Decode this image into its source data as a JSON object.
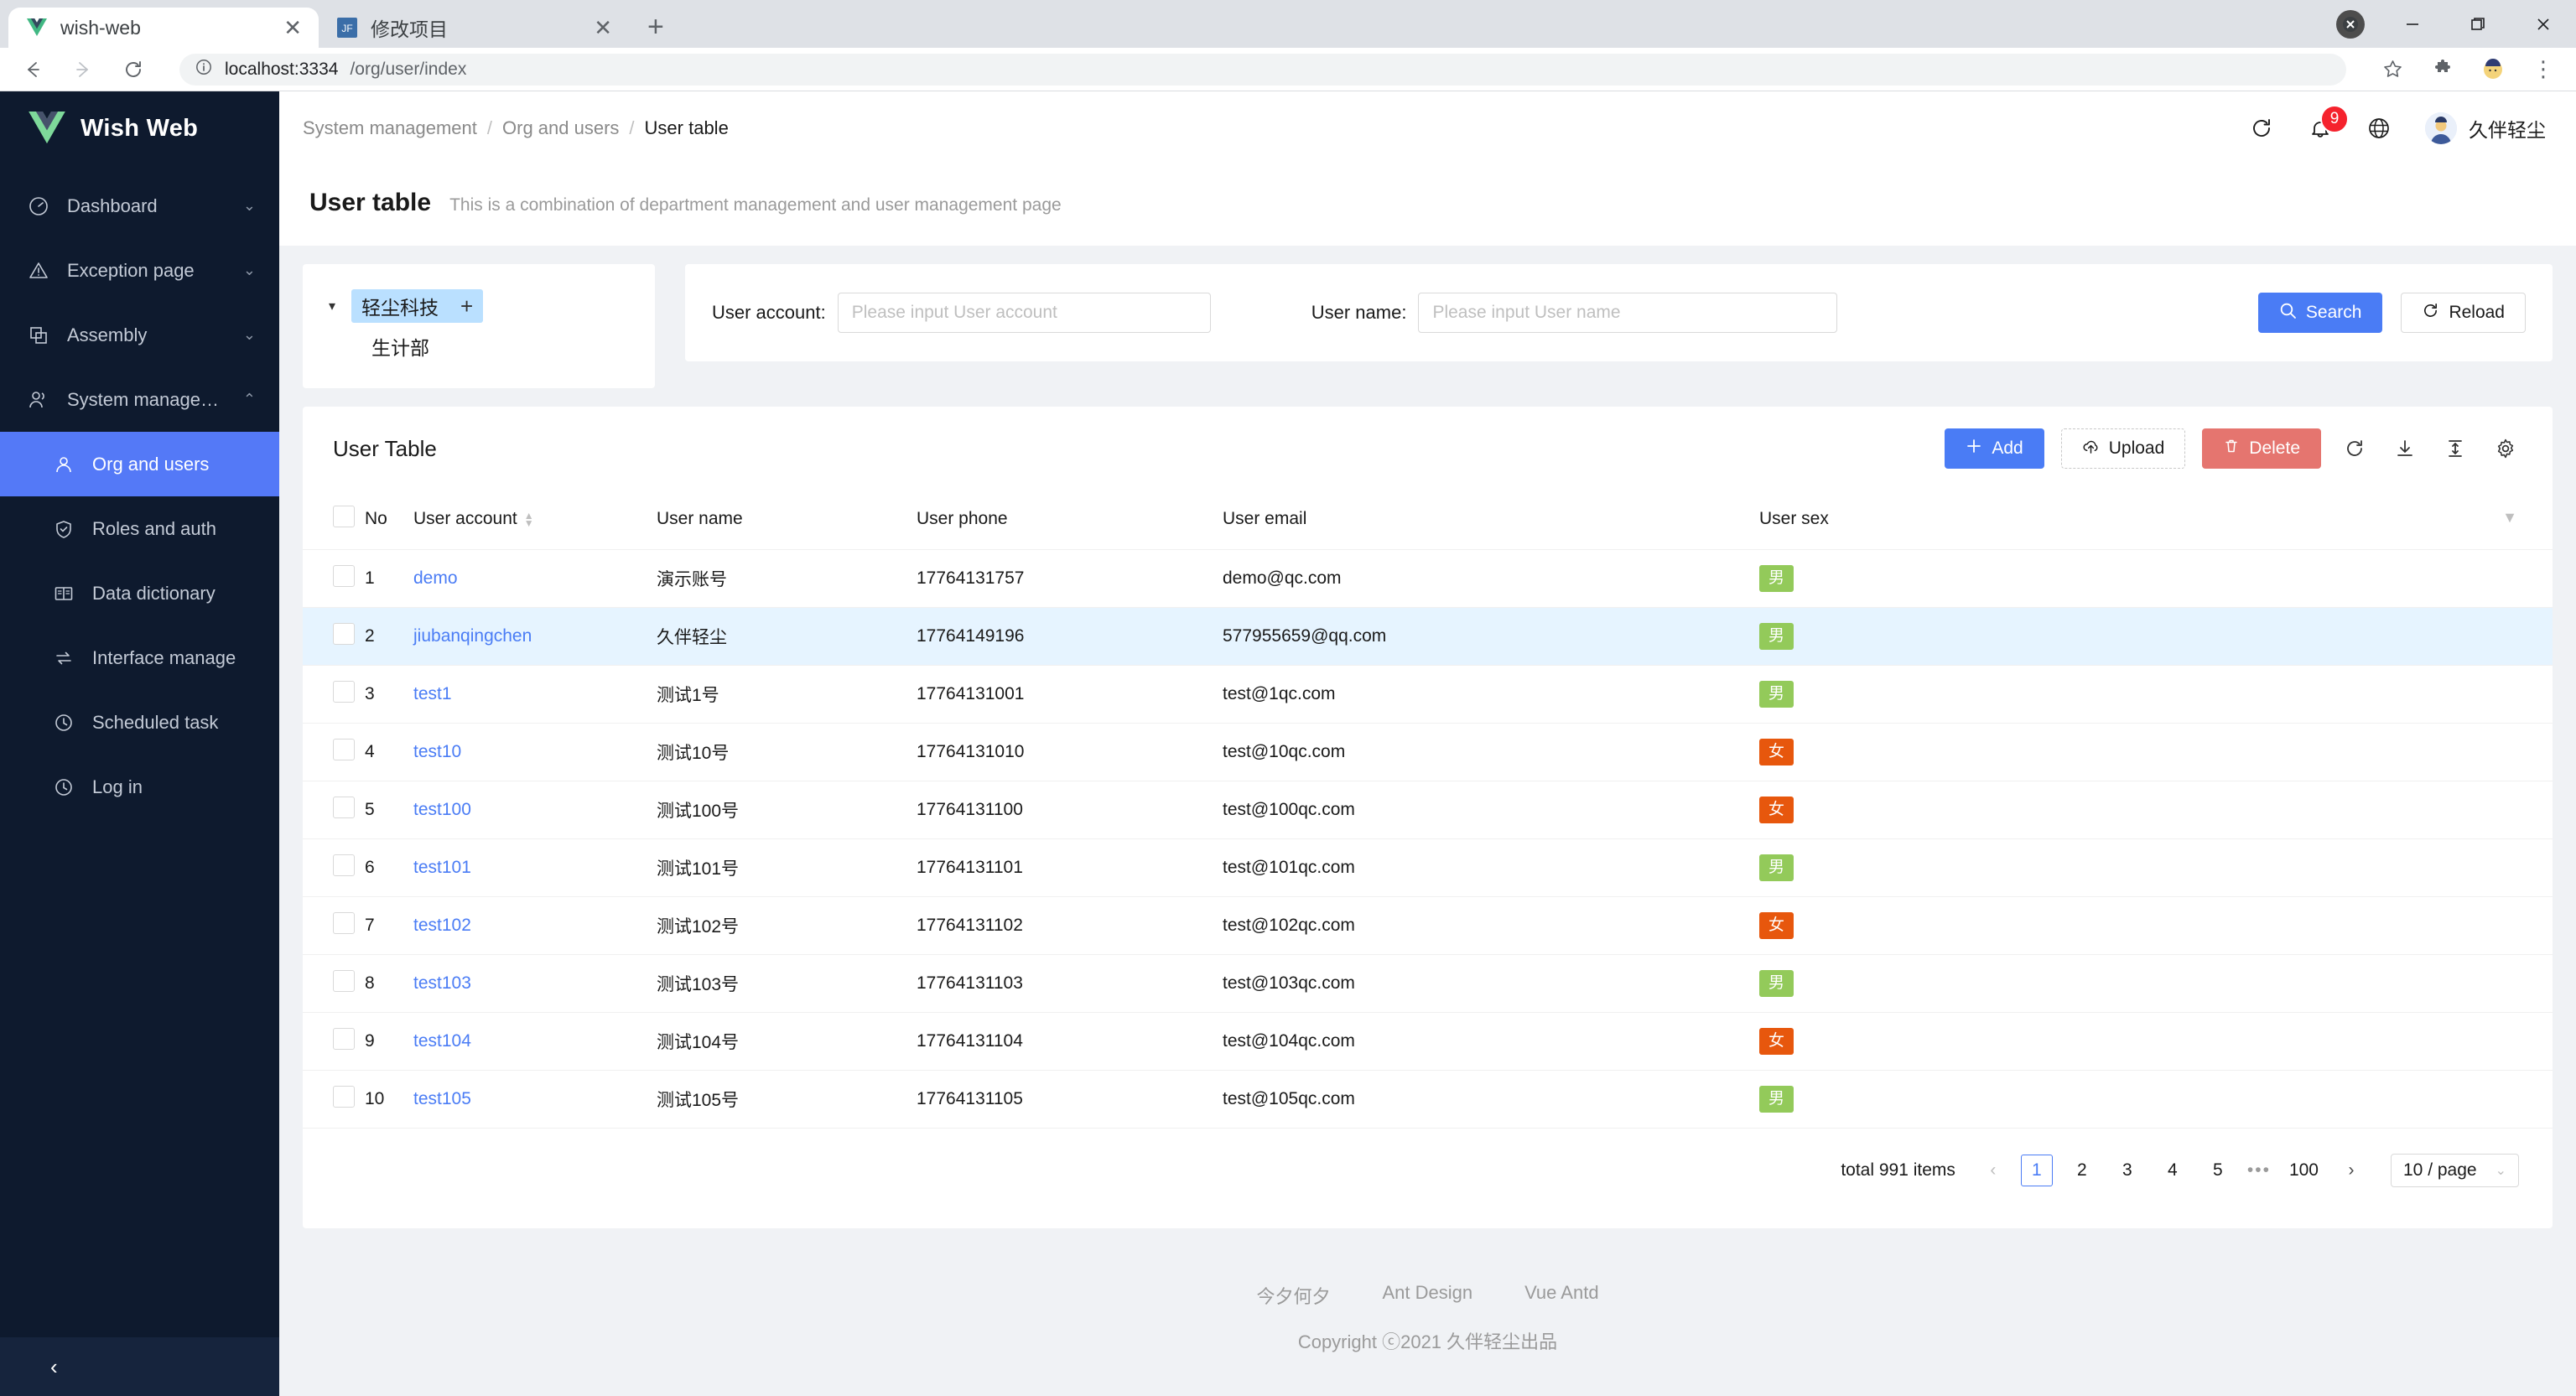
{
  "browser": {
    "tabs": [
      {
        "title": "wish-web",
        "favicon": "vue-icon",
        "active": true
      },
      {
        "title": "修改项目",
        "favicon": "jetbrains-icon",
        "active": false
      }
    ],
    "new_tab_label": "+",
    "close_label": "✕",
    "window": {
      "minimize": "—",
      "maximize": "❐",
      "close": "✕"
    },
    "nav": {
      "back": "←",
      "forward": "→",
      "reload": "⟳"
    },
    "omnibox": {
      "info_icon": "info-icon",
      "host": "localhost:3334",
      "path": "/org/user/index"
    },
    "toolbar_right": {
      "bookmark": "☆",
      "extensions": "puzzle-icon",
      "profile": "profile-avatar",
      "menu": "⋮"
    }
  },
  "sidebar": {
    "brand": "Wish Web",
    "items": [
      {
        "label": "Dashboard",
        "icon": "dashboard-icon",
        "chevron": "⌄"
      },
      {
        "label": "Exception page",
        "icon": "warning-icon",
        "chevron": "⌄"
      },
      {
        "label": "Assembly",
        "icon": "blocks-icon",
        "chevron": "⌄"
      },
      {
        "label": "System managem...",
        "icon": "team-icon",
        "chevron": "⌃"
      }
    ],
    "submenu": [
      {
        "label": "Org and users",
        "icon": "user-icon",
        "active": true
      },
      {
        "label": "Roles and auth",
        "icon": "shield-icon",
        "active": false
      },
      {
        "label": "Data dictionary",
        "icon": "book-icon",
        "active": false
      },
      {
        "label": "Interface manage",
        "icon": "swap-icon",
        "active": false
      },
      {
        "label": "Scheduled task",
        "icon": "clock-icon",
        "active": false
      },
      {
        "label": "Log in",
        "icon": "clock-icon",
        "active": false
      }
    ],
    "collapse_icon": "‹"
  },
  "topbar": {
    "breadcrumb": [
      {
        "label": "System management",
        "current": false
      },
      {
        "label": "Org and users",
        "current": false
      },
      {
        "label": "User table",
        "current": true
      }
    ],
    "separator": "/",
    "reload_icon": "reload-icon",
    "bell_icon": "bell-icon",
    "notification_count": "9",
    "globe_icon": "globe-icon",
    "user_name": "久伴轻尘",
    "avatar_icon": "avatar"
  },
  "pagehead": {
    "title": "User table",
    "subtitle": "This is a combination of department management and user management page"
  },
  "tree": {
    "caret": "▾",
    "root": {
      "label": "轻尘科技",
      "selected": true,
      "add_icon": "+"
    },
    "children": [
      {
        "label": "生计部"
      }
    ]
  },
  "search": {
    "account": {
      "label": "User account:",
      "value": "",
      "placeholder": "Please input User account"
    },
    "name": {
      "label": "User name:",
      "value": "",
      "placeholder": "Please input User name"
    },
    "search_button": {
      "label": "Search",
      "icon": "search-icon"
    },
    "reload_button": {
      "label": "Reload",
      "icon": "reload-icon"
    }
  },
  "table": {
    "title": "User Table",
    "toolbar": {
      "add": {
        "label": "Add",
        "icon": "plus-icon"
      },
      "upload": {
        "label": "Upload",
        "icon": "cloud-upload-icon"
      },
      "delete": {
        "label": "Delete",
        "icon": "trash-icon"
      },
      "icons": [
        "reload-icon",
        "download-icon",
        "column-height-icon",
        "gear-icon"
      ]
    },
    "columns": [
      {
        "key": "no",
        "label": "No"
      },
      {
        "key": "account",
        "label": "User account",
        "sortable": true
      },
      {
        "key": "name",
        "label": "User name"
      },
      {
        "key": "phone",
        "label": "User phone"
      },
      {
        "key": "email",
        "label": "User email"
      },
      {
        "key": "sex",
        "label": "User sex",
        "filterable": true
      }
    ],
    "rows": [
      {
        "no": "1",
        "account": "demo",
        "name": "演示账号",
        "phone": "17764131757",
        "email": "demo@qc.com",
        "sex": "男",
        "hovered": false
      },
      {
        "no": "2",
        "account": "jiubanqingchen",
        "name": "久伴轻尘",
        "phone": "17764149196",
        "email": "577955659@qq.com",
        "sex": "男",
        "hovered": true
      },
      {
        "no": "3",
        "account": "test1",
        "name": "测试1号",
        "phone": "17764131001",
        "email": "test@1qc.com",
        "sex": "男",
        "hovered": false
      },
      {
        "no": "4",
        "account": "test10",
        "name": "测试10号",
        "phone": "17764131010",
        "email": "test@10qc.com",
        "sex": "女",
        "hovered": false
      },
      {
        "no": "5",
        "account": "test100",
        "name": "测试100号",
        "phone": "17764131100",
        "email": "test@100qc.com",
        "sex": "女",
        "hovered": false
      },
      {
        "no": "6",
        "account": "test101",
        "name": "测试101号",
        "phone": "17764131101",
        "email": "test@101qc.com",
        "sex": "男",
        "hovered": false
      },
      {
        "no": "7",
        "account": "test102",
        "name": "测试102号",
        "phone": "17764131102",
        "email": "test@102qc.com",
        "sex": "女",
        "hovered": false
      },
      {
        "no": "8",
        "account": "test103",
        "name": "测试103号",
        "phone": "17764131103",
        "email": "test@103qc.com",
        "sex": "男",
        "hovered": false
      },
      {
        "no": "9",
        "account": "test104",
        "name": "测试104号",
        "phone": "17764131104",
        "email": "test@104qc.com",
        "sex": "女",
        "hovered": false
      },
      {
        "no": "10",
        "account": "test105",
        "name": "测试105号",
        "phone": "17764131105",
        "email": "test@105qc.com",
        "sex": "男",
        "hovered": false
      }
    ]
  },
  "pagination": {
    "total_text": "total 991 items",
    "prev": "‹",
    "next": "›",
    "pages": [
      "1",
      "2",
      "3",
      "4",
      "5"
    ],
    "current_page": "1",
    "dots": "•••",
    "last_page": "100",
    "page_size": "10 / page",
    "caret": "⌄"
  },
  "footer": {
    "links": [
      "今夕何夕",
      "Ant Design",
      "Vue Antd"
    ],
    "copyright": "Copyright ⓒ2021 久伴轻尘出品"
  },
  "colors": {
    "sidebar_bg": "#0e1a2e",
    "accent": "#4a7cf5",
    "active_menu": "#5479f7",
    "danger": "#e5756f",
    "tag_male": "#93ca5a",
    "tag_female": "#e7570d",
    "row_hover": "#e6f4ff",
    "badge": "#f5222d"
  }
}
